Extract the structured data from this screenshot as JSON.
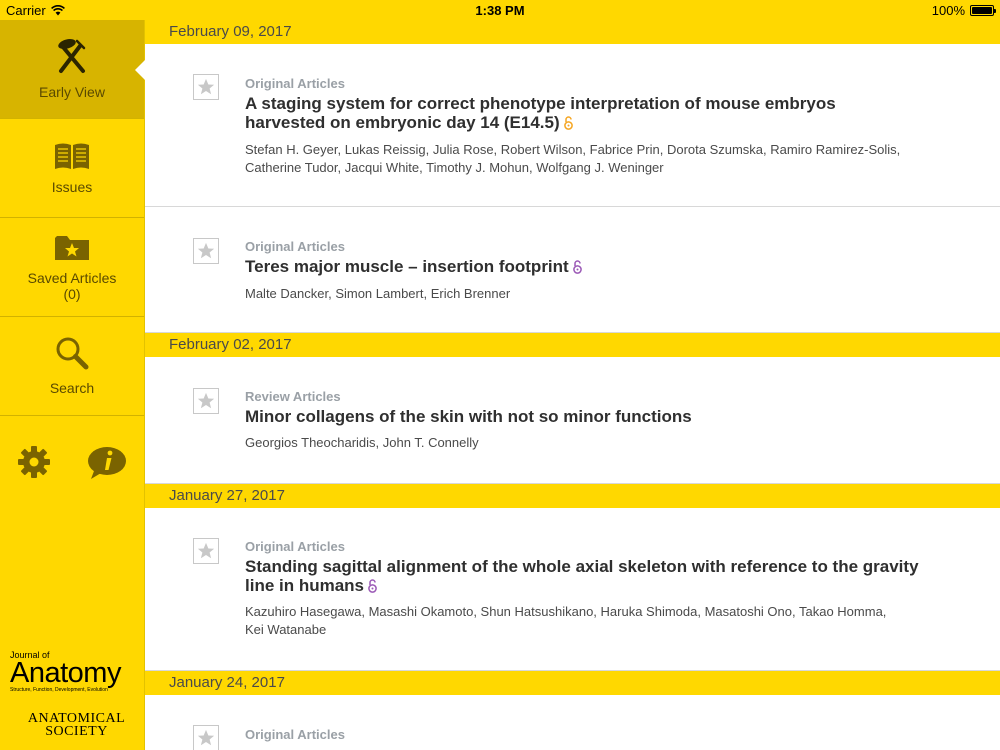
{
  "status_bar": {
    "carrier": "Carrier",
    "time": "1:38 PM",
    "battery": "100%"
  },
  "sidebar": {
    "items": [
      {
        "label": "Early View",
        "icon": "early-view-icon",
        "active": true
      },
      {
        "label": "Issues",
        "icon": "book-icon"
      },
      {
        "label": "Saved Articles",
        "count": "(0)",
        "icon": "folder-star-icon"
      },
      {
        "label": "Search",
        "icon": "search-icon"
      }
    ],
    "utility_icons": [
      "gear-icon",
      "info-icon"
    ],
    "logo": {
      "small": "Journal of",
      "big": "Anatomy",
      "tagline": "Structure, Function, Development, Evolution"
    },
    "society": {
      "line1": "ANATOMICAL",
      "line2": "SOCIETY"
    }
  },
  "colors": {
    "accent": "#ffd800",
    "active": "#d7b400",
    "oa_orange": "#f5a623",
    "oa_purple": "#9b59b6"
  },
  "groups": [
    {
      "date": "February 09, 2017",
      "articles": [
        {
          "type": "Original Articles",
          "title_line1": "A staging system for correct phenotype interpretation of mouse embryos",
          "title_line2": "harvested on embryonic day 14 (E14.5)",
          "authors_line1": "Stefan H. Geyer, Lukas Reissig, Julia Rose, Robert Wilson, Fabrice Prin, Dorota Szumska, Ramiro Ramirez-Solis,",
          "authors_line2": "Catherine Tudor, Jacqui White, Timothy J. Mohun, Wolfgang J. Weninger",
          "oa_icon": "open-access-orange-icon"
        },
        {
          "type": "Original Articles",
          "title_line1": "Teres major muscle – insertion footprint",
          "authors_line1": "Malte Dancker, Simon Lambert, Erich Brenner",
          "oa_icon": "open-access-purple-icon"
        }
      ]
    },
    {
      "date": "February 02, 2017",
      "articles": [
        {
          "type": "Review Articles",
          "title_line1": "Minor collagens of the skin with not so minor functions",
          "authors_line1": "Georgios Theocharidis, John T. Connelly"
        }
      ]
    },
    {
      "date": "January 27, 2017",
      "articles": [
        {
          "type": "Original Articles",
          "title_line1": "Standing sagittal alignment of the whole axial skeleton with reference to the gravity",
          "title_line2": "line in humans",
          "authors_line1": "Kazuhiro Hasegawa, Masashi Okamoto, Shun Hatsushikano, Haruka Shimoda, Masatoshi Ono, Takao Homma,",
          "authors_line2": "Kei Watanabe",
          "oa_icon": "open-access-purple-icon"
        }
      ]
    },
    {
      "date": "January 24, 2017",
      "articles": [
        {
          "type": "Original Articles"
        }
      ]
    }
  ]
}
